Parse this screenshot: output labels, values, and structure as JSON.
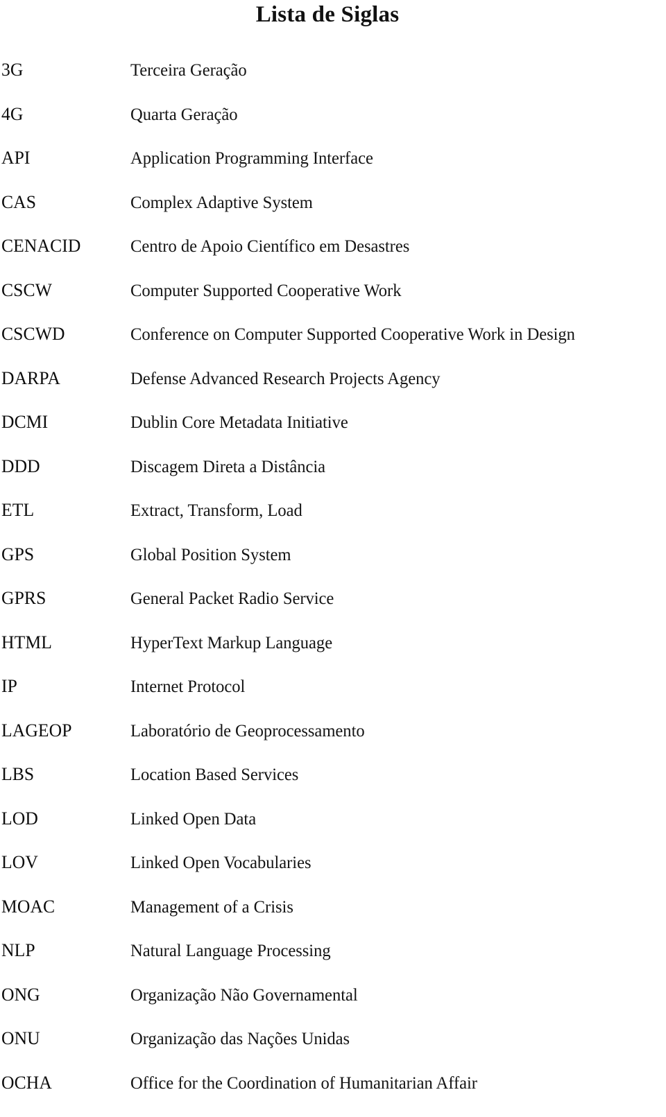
{
  "document": {
    "title": "Lista de Siglas",
    "language": "pt-BR",
    "entries": [
      {
        "term": "3G",
        "definition": "Terceira Geração"
      },
      {
        "term": "4G",
        "definition": "Quarta Geração"
      },
      {
        "term": "API",
        "definition": "Application Programming Interface"
      },
      {
        "term": "CAS",
        "definition": "Complex Adaptive System"
      },
      {
        "term": "CENACID",
        "definition": "Centro de Apoio Científico em Desastres"
      },
      {
        "term": "CSCW",
        "definition": "Computer Supported Cooperative Work"
      },
      {
        "term": "CSCWD",
        "definition": "Conference on Computer Supported Cooperative Work in Design"
      },
      {
        "term": "DARPA",
        "definition": "Defense Advanced Research Projects Agency"
      },
      {
        "term": "DCMI",
        "definition": "Dublin Core Metadata Initiative"
      },
      {
        "term": "DDD",
        "definition": "Discagem Direta a Distância"
      },
      {
        "term": "ETL",
        "definition": "Extract, Transform, Load"
      },
      {
        "term": "GPS",
        "definition": "Global Position System"
      },
      {
        "term": "GPRS",
        "definition": "General Packet Radio Service"
      },
      {
        "term": "HTML",
        "definition": "HyperText Markup Language"
      },
      {
        "term": "IP",
        "definition": "Internet Protocol"
      },
      {
        "term": "LAGEOP",
        "definition": "Laboratório de Geoprocessamento"
      },
      {
        "term": "LBS",
        "definition": "Location Based Services"
      },
      {
        "term": "LOD",
        "definition": "Linked Open Data"
      },
      {
        "term": "LOV",
        "definition": "Linked Open Vocabularies"
      },
      {
        "term": "MOAC",
        "definition": "Management of a Crisis"
      },
      {
        "term": "NLP",
        "definition": "Natural Language Processing"
      },
      {
        "term": "ONG",
        "definition": "Organização Não Governamental"
      },
      {
        "term": "ONU",
        "definition": "Organização das Nações Unidas"
      },
      {
        "term": "OCHA",
        "definition": "Office for the Coordination of Humanitarian Affair"
      }
    ]
  }
}
